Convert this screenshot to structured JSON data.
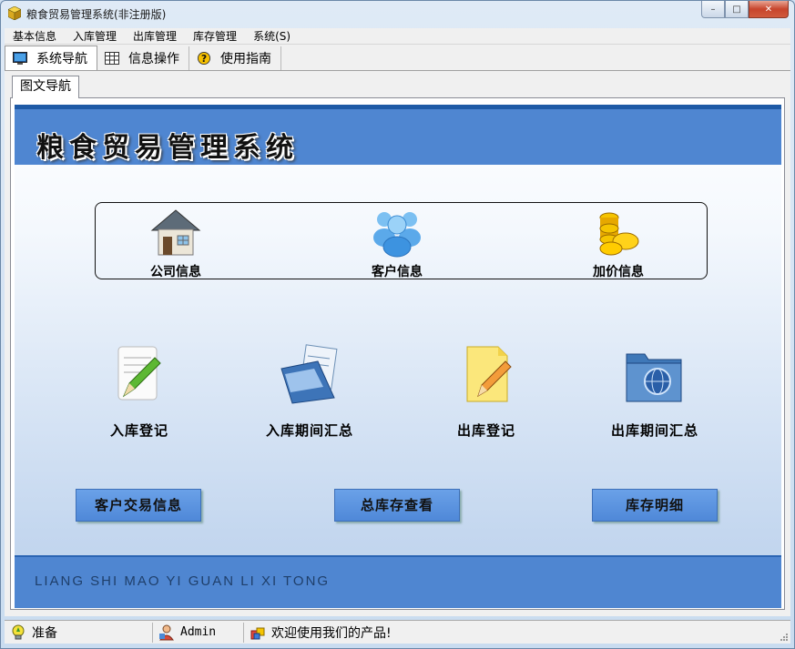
{
  "window": {
    "title": "粮食贸易管理系统(非注册版)",
    "controls": {
      "minimize": "–",
      "maximize": "□",
      "close": "✕"
    }
  },
  "menu": [
    "基本信息",
    "入库管理",
    "出库管理",
    "库存管理",
    "系统(S)"
  ],
  "toolbar_tabs": [
    {
      "label": "系统导航",
      "icon": "monitor-icon",
      "active": true
    },
    {
      "label": "信息操作",
      "icon": "grid-icon",
      "active": false
    },
    {
      "label": "使用指南",
      "icon": "help-icon",
      "active": false
    }
  ],
  "sub_tab": "图文导航",
  "header": {
    "title": "粮食贸易管理系统"
  },
  "info_items": [
    {
      "label": "公司信息",
      "icon": "house-icon"
    },
    {
      "label": "客户信息",
      "icon": "users-icon"
    },
    {
      "label": "加价信息",
      "icon": "coins-icon"
    }
  ],
  "big_items": [
    {
      "label": "入库登记",
      "icon": "notepad-pencil-icon"
    },
    {
      "label": "入库期间汇总",
      "icon": "document-folder-icon"
    },
    {
      "label": "出库登记",
      "icon": "note-pencil-icon"
    },
    {
      "label": "出库期间汇总",
      "icon": "globe-folder-icon"
    }
  ],
  "buttons": [
    "客户交易信息",
    "总库存查看",
    "库存明细"
  ],
  "footer": {
    "text": "LIANG SHI MAO YI GUAN LI XI TONG"
  },
  "status": [
    {
      "text": "准备",
      "icon": "bulb-icon"
    },
    {
      "text": "Admin",
      "icon": "user-icon"
    },
    {
      "text": "欢迎使用我们的产品!",
      "icon": "gift-icon"
    }
  ],
  "colors": {
    "header_band": "#4f86d1",
    "header_dark": "#1e5aa6",
    "button": "#5a93e0"
  }
}
